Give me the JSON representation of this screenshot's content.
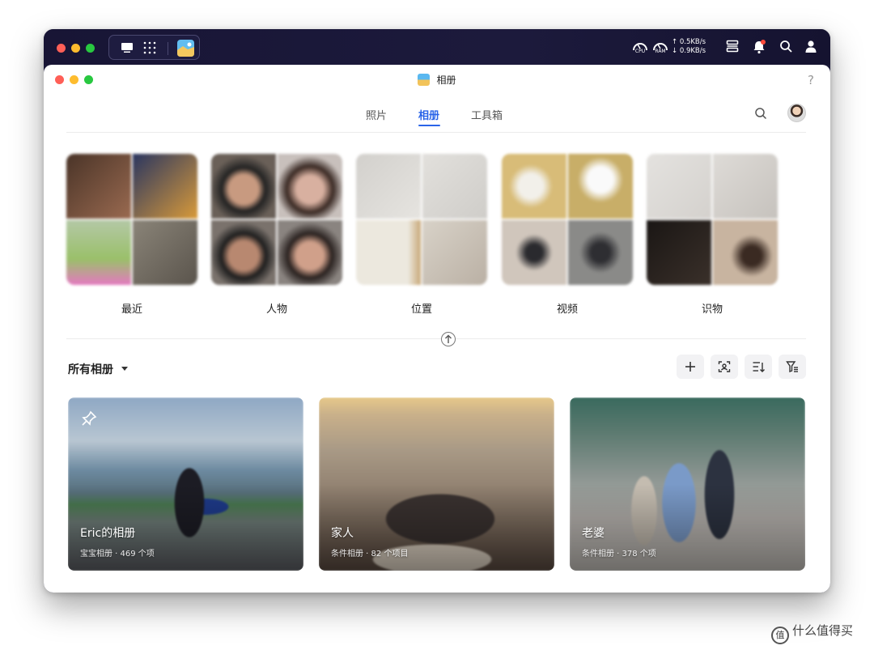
{
  "system_bar": {
    "monitors": [
      {
        "label": "CPU"
      },
      {
        "label": "RAM"
      }
    ],
    "net_up": "0.5KB/s",
    "net_down": "0.9KB/s",
    "icons": [
      "desktop-icon",
      "apps-grid-icon",
      "photos-app-icon",
      "widgets-icon",
      "notification-bell-icon",
      "search-icon",
      "user-icon"
    ]
  },
  "window": {
    "title": "相册",
    "help": "?"
  },
  "tabs": [
    {
      "label": "照片",
      "active": false
    },
    {
      "label": "相册",
      "active": true
    },
    {
      "label": "工具箱",
      "active": false
    }
  ],
  "categories": [
    {
      "label": "最近",
      "tiles": [
        "#6b4a3a",
        "#3a4a70",
        "#8aa47a",
        "#7a7062"
      ]
    },
    {
      "label": "人物",
      "tiles": [
        "#b89078",
        "#c9a292",
        "#8a6e60",
        "#a88474"
      ]
    },
    {
      "label": "位置",
      "tiles": [
        "#d8d6d2",
        "#dddbd6",
        "#e6e2d8",
        "#cfc8bc"
      ]
    },
    {
      "label": "视频",
      "tiles": [
        "#d9c080",
        "#c8b070",
        "#a89e92",
        "#6c6a6a"
      ]
    },
    {
      "label": "识物",
      "tiles": [
        "#e0dedb",
        "#d6d3cf",
        "#2a2522",
        "#b8a594"
      ]
    }
  ],
  "albums_section": {
    "title": "所有相册",
    "toolbar": [
      "add-icon",
      "face-scan-icon",
      "sort-icon",
      "filter-icon"
    ]
  },
  "albums": [
    {
      "title": "Eric的相册",
      "subtitle": "宝宝相册 · 469 个项",
      "pinned": true
    },
    {
      "title": "家人",
      "subtitle": "条件相册 · 82 个项目",
      "pinned": false
    },
    {
      "title": "老婆",
      "subtitle": "条件相册 · 378 个项",
      "pinned": false
    }
  ],
  "watermark": {
    "text": "什么值得买",
    "icon": "值"
  },
  "colors": {
    "accent": "#2a64e8",
    "system_bar": "#1a1838"
  }
}
